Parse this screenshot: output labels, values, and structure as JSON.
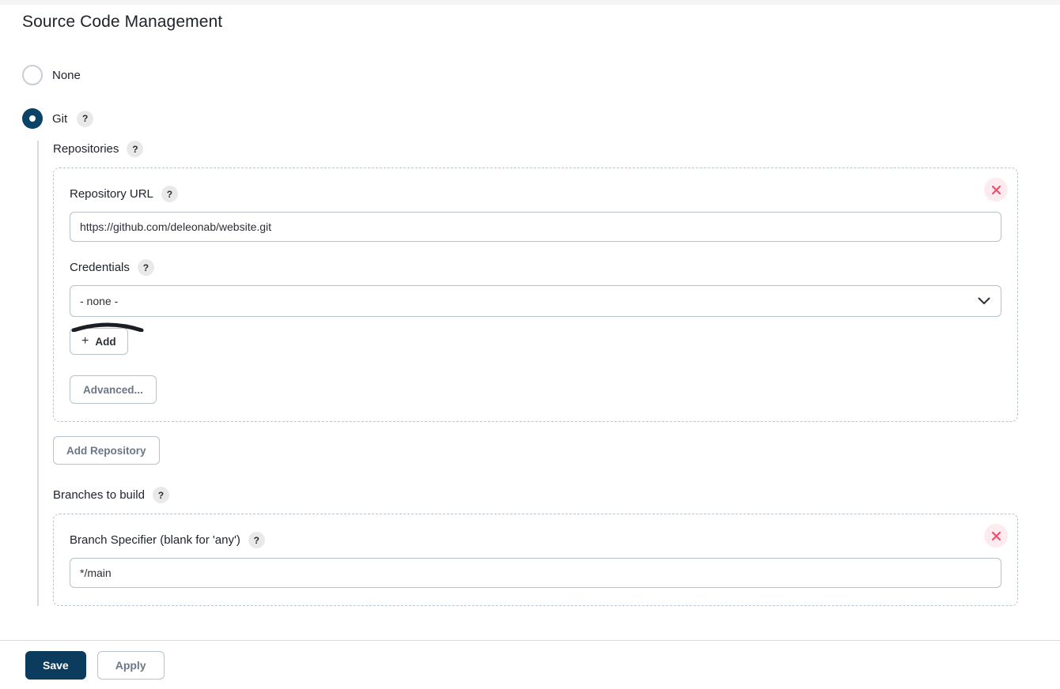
{
  "page": {
    "title": "Source Code Management"
  },
  "scm_options": [
    {
      "label": "None",
      "selected": false
    },
    {
      "label": "Git",
      "selected": true,
      "help": "?"
    }
  ],
  "git": {
    "repositories": {
      "label": "Repositories",
      "help": "?",
      "repository": {
        "url_field": {
          "label": "Repository URL",
          "help": "?",
          "value": "https://github.com/deleonab/website.git"
        },
        "credentials_field": {
          "label": "Credentials",
          "help": "?",
          "value": "- none -",
          "options": [
            "- none -"
          ]
        },
        "add_credentials_button": {
          "icon": "plus-icon",
          "label": "Add"
        },
        "advanced_button": "Advanced...",
        "delete_button": "×"
      },
      "add_repository_button": "Add Repository"
    },
    "branches": {
      "label": "Branches to build",
      "help": "?",
      "branch": {
        "specifier_field": {
          "label": "Branch Specifier (blank for 'any')",
          "help": "?",
          "value": "*/main"
        },
        "delete_button": "×"
      }
    }
  },
  "action_bar": {
    "save_label": "Save",
    "apply_label": "Apply"
  },
  "colors": {
    "accent_navy": "#0b3c5d",
    "radio_selected": "#0b4268",
    "delete_red": "#e8536b",
    "delete_bg": "#fdecef",
    "muted_text": "#6b7687",
    "border": "#b6c2cc",
    "dashed_border": "#b9c3cc"
  }
}
